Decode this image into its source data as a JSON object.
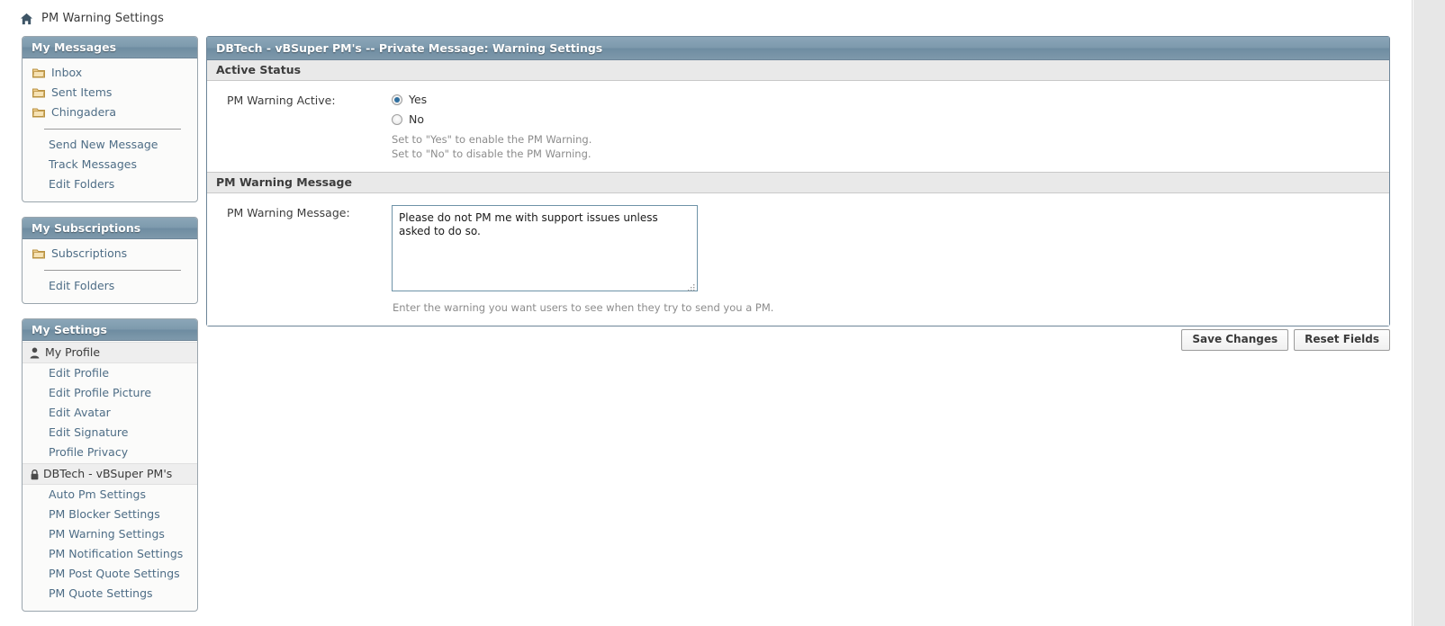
{
  "breadcrumb": {
    "home_icon": "home-icon",
    "title": "PM Warning Settings"
  },
  "sidebar": {
    "panels": [
      {
        "title": "My Messages",
        "folders": [
          {
            "label": "Inbox",
            "icon": "folder-icon"
          },
          {
            "label": "Sent Items",
            "icon": "folder-icon"
          },
          {
            "label": "Chingadera",
            "icon": "folder-icon"
          }
        ],
        "links": [
          {
            "label": "Send New Message"
          },
          {
            "label": "Track Messages"
          },
          {
            "label": "Edit Folders"
          }
        ]
      },
      {
        "title": "My Subscriptions",
        "folders": [
          {
            "label": "Subscriptions",
            "icon": "folder-icon"
          }
        ],
        "links": [
          {
            "label": "Edit Folders"
          }
        ]
      }
    ],
    "settings_panel": {
      "title": "My Settings",
      "groups": [
        {
          "header": {
            "label": "My Profile",
            "icon": "person-icon",
            "selected": true
          },
          "links": [
            {
              "label": "Edit Profile"
            },
            {
              "label": "Edit Profile Picture"
            },
            {
              "label": "Edit Avatar"
            },
            {
              "label": "Edit Signature"
            },
            {
              "label": "Profile Privacy"
            }
          ]
        },
        {
          "header": {
            "label": "DBTech - vBSuper PM's",
            "icon": "lock-icon",
            "selected": true
          },
          "links": [
            {
              "label": "Auto Pm Settings"
            },
            {
              "label": "PM Blocker Settings"
            },
            {
              "label": "PM Warning Settings"
            },
            {
              "label": "PM Notification Settings"
            },
            {
              "label": "PM Post Quote Settings"
            },
            {
              "label": "PM Quote Settings"
            }
          ]
        }
      ]
    }
  },
  "main": {
    "title": "DBTech - vBSuper PM's -- Private Message: Warning Settings",
    "sections": {
      "active_status": {
        "heading": "Active Status",
        "field_label": "PM Warning Active:",
        "options": [
          {
            "label": "Yes",
            "checked": true
          },
          {
            "label": "No",
            "checked": false
          }
        ],
        "hint_line1": "Set to \"Yes\" to enable the PM Warning.",
        "hint_line2": "Set to \"No\" to disable the PM Warning."
      },
      "warning_message": {
        "heading": "PM Warning Message",
        "field_label": "PM Warning Message:",
        "textarea_value": "Please do not PM me with support issues unless asked to do so.",
        "textarea_placeholder": "",
        "hint": "Enter the warning you want users to see when they try to send you a PM."
      }
    }
  },
  "buttons": {
    "save_label": "Save Changes",
    "reset_label": "Reset Fields"
  },
  "colors": {
    "header_blue": "#7d9aad",
    "panel_border": "#6d8598",
    "link_blue": "#4e6d86",
    "section_band": "#e9e9e9",
    "radio_dot": "#2f6f9f",
    "folder_gold": "#e8c477"
  }
}
